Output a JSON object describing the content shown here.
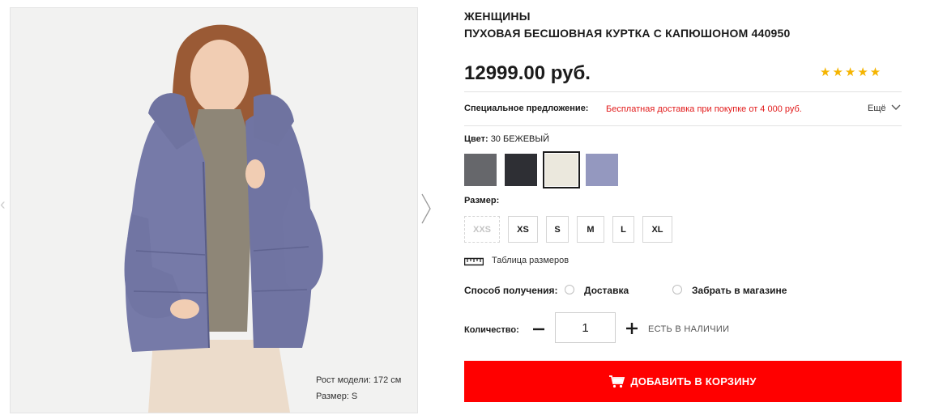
{
  "product": {
    "category": "ЖЕНЩИНЫ",
    "title": "ПУХОВАЯ БЕСШОВНАЯ КУРТКА С КАПЮШОНОМ 440950",
    "price": "12999.00 руб.",
    "stars": "★★★★★",
    "rating": 5
  },
  "image": {
    "model_height": "Рост модели: 172 см",
    "model_size": "Размер: S"
  },
  "offer": {
    "label": "Специальное предложение:",
    "text": "Бесплатная доставка при покупке от 4 000 руб.",
    "more": "Ещё"
  },
  "color": {
    "label": "Цвет:",
    "value": "30 БЕЖЕВЫЙ",
    "swatches": [
      {
        "hex": "#66676b",
        "selected": false
      },
      {
        "hex": "#2e2f34",
        "selected": false
      },
      {
        "hex": "#ebe8dd",
        "selected": true
      },
      {
        "hex": "#9498bf",
        "selected": false
      }
    ]
  },
  "size": {
    "label": "Размер:",
    "options": [
      {
        "label": "XXS",
        "available": false
      },
      {
        "label": "XS",
        "available": true
      },
      {
        "label": "S",
        "available": true
      },
      {
        "label": "M",
        "available": true
      },
      {
        "label": "L",
        "available": true
      },
      {
        "label": "XL",
        "available": true
      }
    ],
    "chart_link": "Таблица размеров",
    "chart_icon": "ruler-icon"
  },
  "delivery": {
    "label": "Способ получения:",
    "options": [
      "Доставка",
      "Забрать в магазине"
    ]
  },
  "quantity": {
    "label": "Количество:",
    "value": "1",
    "stock": "ЕСТЬ В НАЛИЧИИ"
  },
  "cart": {
    "label": "ДОБАВИТЬ В КОРЗИНУ",
    "icon": "cart-icon"
  },
  "colors": {
    "accent": "#ff0000",
    "offer": "#e21b1b",
    "star": "#f5b400"
  }
}
